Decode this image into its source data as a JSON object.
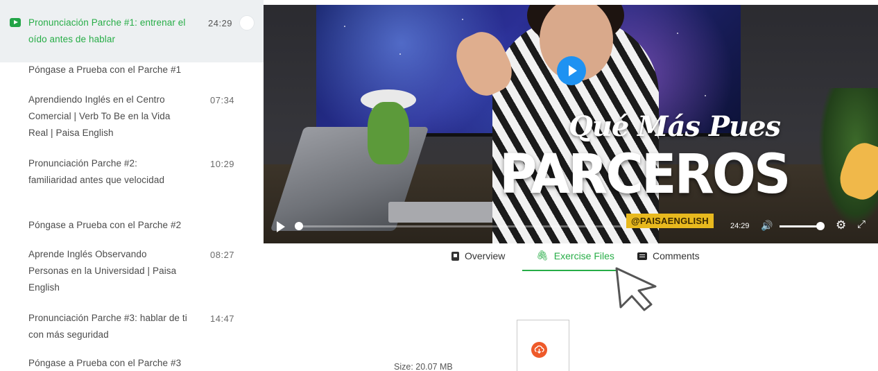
{
  "sidebar": {
    "lessons": [
      {
        "title": "Pronunciación Parche #1: entrenar el oído antes de hablar",
        "duration": "24:29",
        "active": true
      },
      {
        "title": "Póngase a Prueba con el Parche #1",
        "duration": ""
      },
      {
        "title": "Aprendiendo Inglés en el Centro Comercial | Verb To Be en la Vida Real | Paisa English",
        "duration": "07:34"
      },
      {
        "title": "Pronunciación Parche #2: familiaridad antes que velocidad",
        "duration": "10:29"
      },
      {
        "title": "Póngase a Prueba con el Parche #2",
        "duration": ""
      },
      {
        "title": "Aprende Inglés Observando Personas en la Universidad | Paisa English",
        "duration": "08:27"
      },
      {
        "title": "Pronunciación Parche #3: hablar de ti con más seguridad",
        "duration": "14:47"
      },
      {
        "title": "Póngase a Prueba con el Parche #3",
        "duration": ""
      }
    ]
  },
  "video": {
    "overlay_line1": "Qué Más Pues",
    "overlay_line2": "PARCEROS",
    "handle": "@PAISAENGLISH",
    "time": "24:29",
    "progress": 0,
    "volume": 0.9
  },
  "tabs": [
    {
      "label": "Overview",
      "icon": "notebook-icon"
    },
    {
      "label": "Exercise Files",
      "icon": "paperclip-icon",
      "active": true
    },
    {
      "label": "Comments",
      "icon": "comment-icon"
    }
  ],
  "files": {
    "size": "Size: 20.07 MB"
  },
  "colors": {
    "accent": "#27ad47",
    "player_blue": "#1e92f2",
    "download_orange": "#ee5a2a"
  }
}
